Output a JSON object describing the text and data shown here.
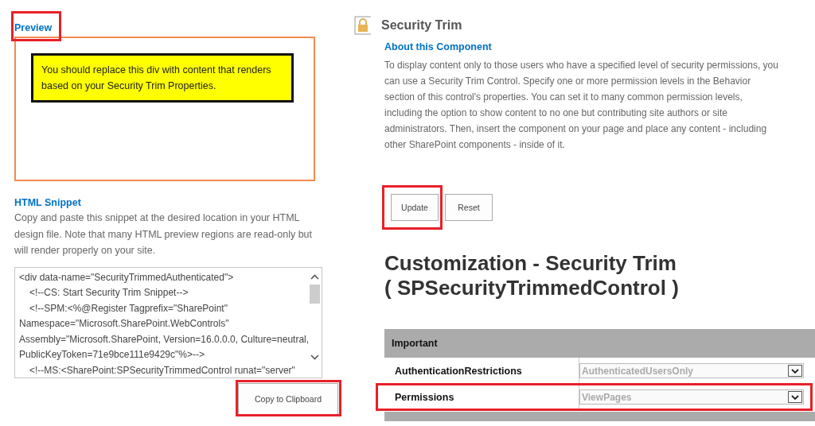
{
  "preview": {
    "heading": "Preview",
    "heading_highlighted": true,
    "notice": "You should replace this div with content that renders based on your Security Trim Properties."
  },
  "snippet": {
    "heading": "HTML Snippet",
    "description": "Copy and paste this snippet at the desired location in your HTML design file. Note that many HTML preview regions are read-only but will render properly on your site.",
    "code_lines": [
      {
        "text": "<div data-name=\"SecurityTrimmedAuthenticated\">",
        "indented": false
      },
      {
        "text": "<!--CS: Start Security Trim Snippet-->",
        "indented": true
      },
      {
        "text": "<!--SPM:<%@Register Tagprefix=\"SharePoint\"",
        "indented": true
      },
      {
        "text": "Namespace=\"Microsoft.SharePoint.WebControls\"",
        "indented": false
      },
      {
        "text": "Assembly=\"Microsoft.SharePoint, Version=16.0.0.0, Culture=neutral,",
        "indented": false
      },
      {
        "text": "PublicKeyToken=71e9bce111e9429c\"%>-->",
        "indented": false
      },
      {
        "text": "<!--MS:<SharePoint:SPSecurityTrimmedControl runat=\"server\"",
        "indented": true
      }
    ],
    "copy_button": {
      "label": "Copy to Clipboard",
      "highlighted": true
    }
  },
  "component": {
    "title": "Security Trim",
    "about_heading": "About this Component",
    "about_text": "To display content only to those users who have a specified level of security permissions, you can use a Security Trim Control. Specify one or more permission levels in the Behavior section of this control's properties. You can set it to many common permission levels, including the option to show content to no one but contributing site authors or site administrators. Then, insert the component on your page and place any content - including other SharePoint components - inside of it.",
    "buttons": [
      {
        "label": "Update",
        "highlighted": true
      },
      {
        "label": "Reset",
        "highlighted": false
      }
    ]
  },
  "customization": {
    "title_lines": [
      "Customization - Security Trim",
      "( SPSecurityTrimmedControl )"
    ],
    "section": "Important",
    "properties": [
      {
        "name": "AuthenticationRestrictions",
        "value": "AuthenticatedUsersOnly",
        "highlighted": false
      },
      {
        "name": "Permissions",
        "value": "ViewPages",
        "highlighted": true
      }
    ]
  }
}
